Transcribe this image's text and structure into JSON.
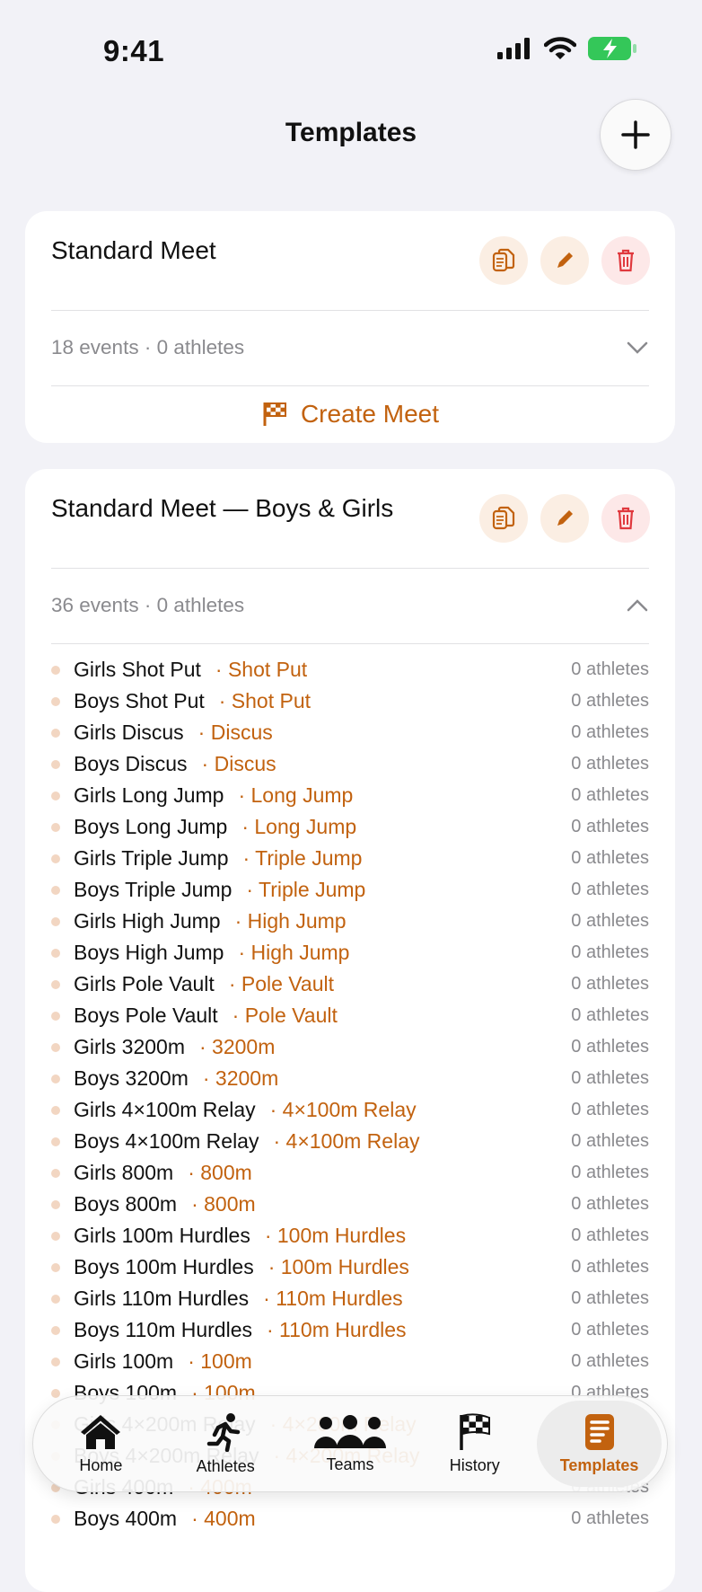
{
  "status": {
    "time": "9:41"
  },
  "header": {
    "title": "Templates"
  },
  "accent": "#c2620f",
  "cards": [
    {
      "name": "Standard Meet",
      "summary": "18 events · 0 athletes",
      "expanded": false,
      "create_label": "Create Meet"
    },
    {
      "name": "Standard Meet — Boys & Girls",
      "summary": "36 events · 0 athletes",
      "expanded": true,
      "events": [
        {
          "name": "Girls Shot Put",
          "category": "· Shot Put",
          "count": "0 athletes"
        },
        {
          "name": "Boys Shot Put",
          "category": "· Shot Put",
          "count": "0 athletes"
        },
        {
          "name": "Girls Discus",
          "category": "· Discus",
          "count": "0 athletes"
        },
        {
          "name": "Boys Discus",
          "category": "· Discus",
          "count": "0 athletes"
        },
        {
          "name": "Girls Long Jump",
          "category": "· Long Jump",
          "count": "0 athletes"
        },
        {
          "name": "Boys Long Jump",
          "category": "· Long Jump",
          "count": "0 athletes"
        },
        {
          "name": "Girls Triple Jump",
          "category": "· Triple Jump",
          "count": "0 athletes"
        },
        {
          "name": "Boys Triple Jump",
          "category": "· Triple Jump",
          "count": "0 athletes"
        },
        {
          "name": "Girls High Jump",
          "category": "· High Jump",
          "count": "0 athletes"
        },
        {
          "name": "Boys High Jump",
          "category": "· High Jump",
          "count": "0 athletes"
        },
        {
          "name": "Girls Pole Vault",
          "category": "· Pole Vault",
          "count": "0 athletes"
        },
        {
          "name": "Boys Pole Vault",
          "category": "· Pole Vault",
          "count": "0 athletes"
        },
        {
          "name": "Girls 3200m",
          "category": "· 3200m",
          "count": "0 athletes"
        },
        {
          "name": "Boys 3200m",
          "category": "· 3200m",
          "count": "0 athletes"
        },
        {
          "name": "Girls 4×100m Relay",
          "category": "· 4×100m Relay",
          "count": "0 athletes"
        },
        {
          "name": "Boys 4×100m Relay",
          "category": "· 4×100m Relay",
          "count": "0 athletes"
        },
        {
          "name": "Girls 800m",
          "category": "· 800m",
          "count": "0 athletes"
        },
        {
          "name": "Boys 800m",
          "category": "· 800m",
          "count": "0 athletes"
        },
        {
          "name": "Girls 100m Hurdles",
          "category": "· 100m Hurdles",
          "count": "0 athletes"
        },
        {
          "name": "Boys 100m Hurdles",
          "category": "· 100m Hurdles",
          "count": "0 athletes"
        },
        {
          "name": "Girls 110m Hurdles",
          "category": "· 110m Hurdles",
          "count": "0 athletes"
        },
        {
          "name": "Boys 110m Hurdles",
          "category": "· 110m Hurdles",
          "count": "0 athletes"
        },
        {
          "name": "Girls 100m",
          "category": "· 100m",
          "count": "0 athletes"
        },
        {
          "name": "Boys 100m",
          "category": "· 100m",
          "count": "0 athletes"
        },
        {
          "name": "Girls 4×200m Relay",
          "category": "· 4×200m Relay",
          "count": "0 athletes"
        },
        {
          "name": "Boys 4×200m Relay",
          "category": "· 4×200m Relay",
          "count": "0 athletes"
        },
        {
          "name": "Girls 400m",
          "category": "· 400m",
          "count": "0 athletes"
        },
        {
          "name": "Boys 400m",
          "category": "· 400m",
          "count": "0 athletes"
        }
      ]
    }
  ],
  "tabs": [
    {
      "label": "Home",
      "icon": "house-icon",
      "active": false
    },
    {
      "label": "Athletes",
      "icon": "runner-icon",
      "active": false
    },
    {
      "label": "Teams",
      "icon": "people-icon",
      "active": false
    },
    {
      "label": "History",
      "icon": "checkered-flag-icon",
      "active": false
    },
    {
      "label": "Templates",
      "icon": "document-icon",
      "active": true
    }
  ]
}
